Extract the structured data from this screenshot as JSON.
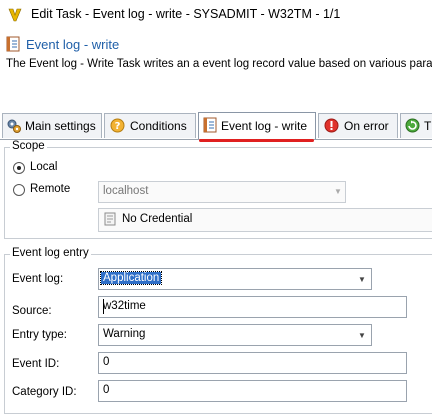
{
  "window": {
    "title": "Edit Task - Event log - write - SYSADMIT - W32TM - 1/1"
  },
  "header": {
    "title": "Event log - write",
    "description": "The Event log - Write Task writes an a event log record value based on various paran"
  },
  "tabs": [
    {
      "label": "Main settings",
      "icon": "gears-icon"
    },
    {
      "label": "Conditions",
      "icon": "question-icon"
    },
    {
      "label": "Event log - write",
      "icon": "event-log-icon",
      "active": true
    },
    {
      "label": "On error",
      "icon": "error-icon"
    },
    {
      "label": "T",
      "icon": "refresh-icon"
    }
  ],
  "scope": {
    "legend": "Scope",
    "local_label": "Local",
    "remote_label": "Remote",
    "selected": "Local",
    "remote_host_placeholder": "localhost",
    "credential_label": "No Credential"
  },
  "entry": {
    "legend": "Event log entry",
    "event_log_label": "Event log:",
    "event_log_value": "Application",
    "source_label": "Source:",
    "source_value": "w32time",
    "entry_type_label": "Entry type:",
    "entry_type_value": "Warning",
    "event_id_label": "Event ID:",
    "event_id_value": "0",
    "category_id_label": "Category ID:",
    "category_id_value": "0"
  },
  "colors": {
    "accent": "#1f5fa8",
    "active_tab_underline": "#e02020",
    "selection": "#2f6fc8"
  }
}
